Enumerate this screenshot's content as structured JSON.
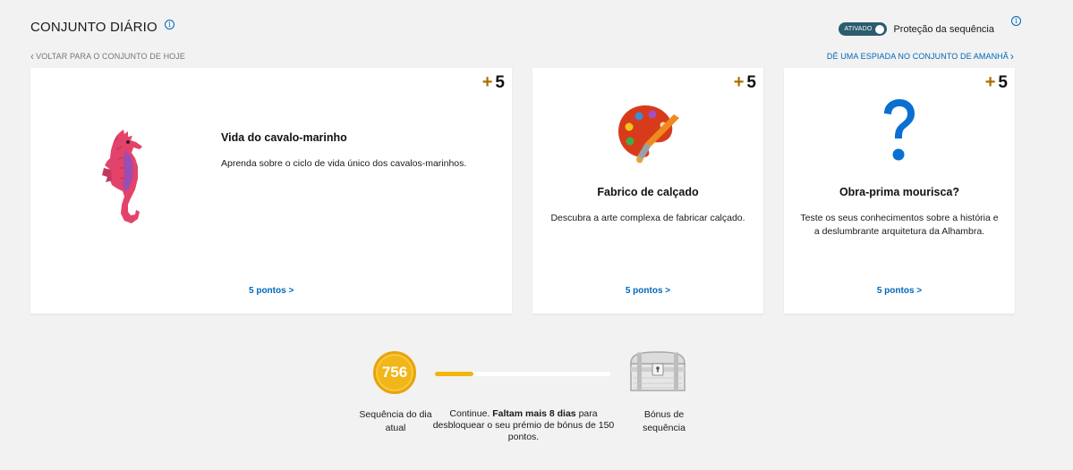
{
  "header": {
    "title": "CONJUNTO DIÁRIO",
    "info_icon": "info-icon"
  },
  "streak_protection": {
    "toggle_label": "ATIVADO",
    "label": "Proteção da sequência",
    "enabled": true
  },
  "nav": {
    "back_label": "VOLTAR PARA O CONJUNTO DE HOJE",
    "peek_label": "DÊ UMA ESPIADA NO CONJUNTO DE AMANHÃ"
  },
  "cards": [
    {
      "plus": "+",
      "points": "5",
      "icon": "seahorse-icon",
      "title": "Vida do cavalo-marinho",
      "description": "Aprenda sobre o ciclo de vida único dos cavalos-marinhos.",
      "link": "5 pontos >"
    },
    {
      "plus": "+",
      "points": "5",
      "icon": "paint-palette-icon",
      "title": "Fabrico de calçado",
      "description": "Descubra a arte complexa de fabricar calçado.",
      "link": "5 pontos >"
    },
    {
      "plus": "+",
      "points": "5",
      "icon": "question-mark-icon",
      "title": "Obra-prima mourisca?",
      "description": "Teste os seus conhecimentos sobre a história e a deslumbrante arquitetura da Alhambra.",
      "link": "5 pontos >"
    }
  ],
  "streak": {
    "count": "756",
    "label": "Sequência do dia atual",
    "continue_prefix": "Continue. ",
    "continue_bold": "Faltam mais 8 dias",
    "continue_suffix": " para desbloquear o seu prémio de bónus de 150 pontos.",
    "progress_fraction": 0.22,
    "bonus_label": "Bónus de sequência",
    "bonus_icon": "treasure-chest-icon"
  },
  "colors": {
    "accent": "#0067b8",
    "toggle": "#2b5c6f",
    "plus": "#a66f00",
    "coin": "#f2b619",
    "progress": "#f0b70a"
  }
}
